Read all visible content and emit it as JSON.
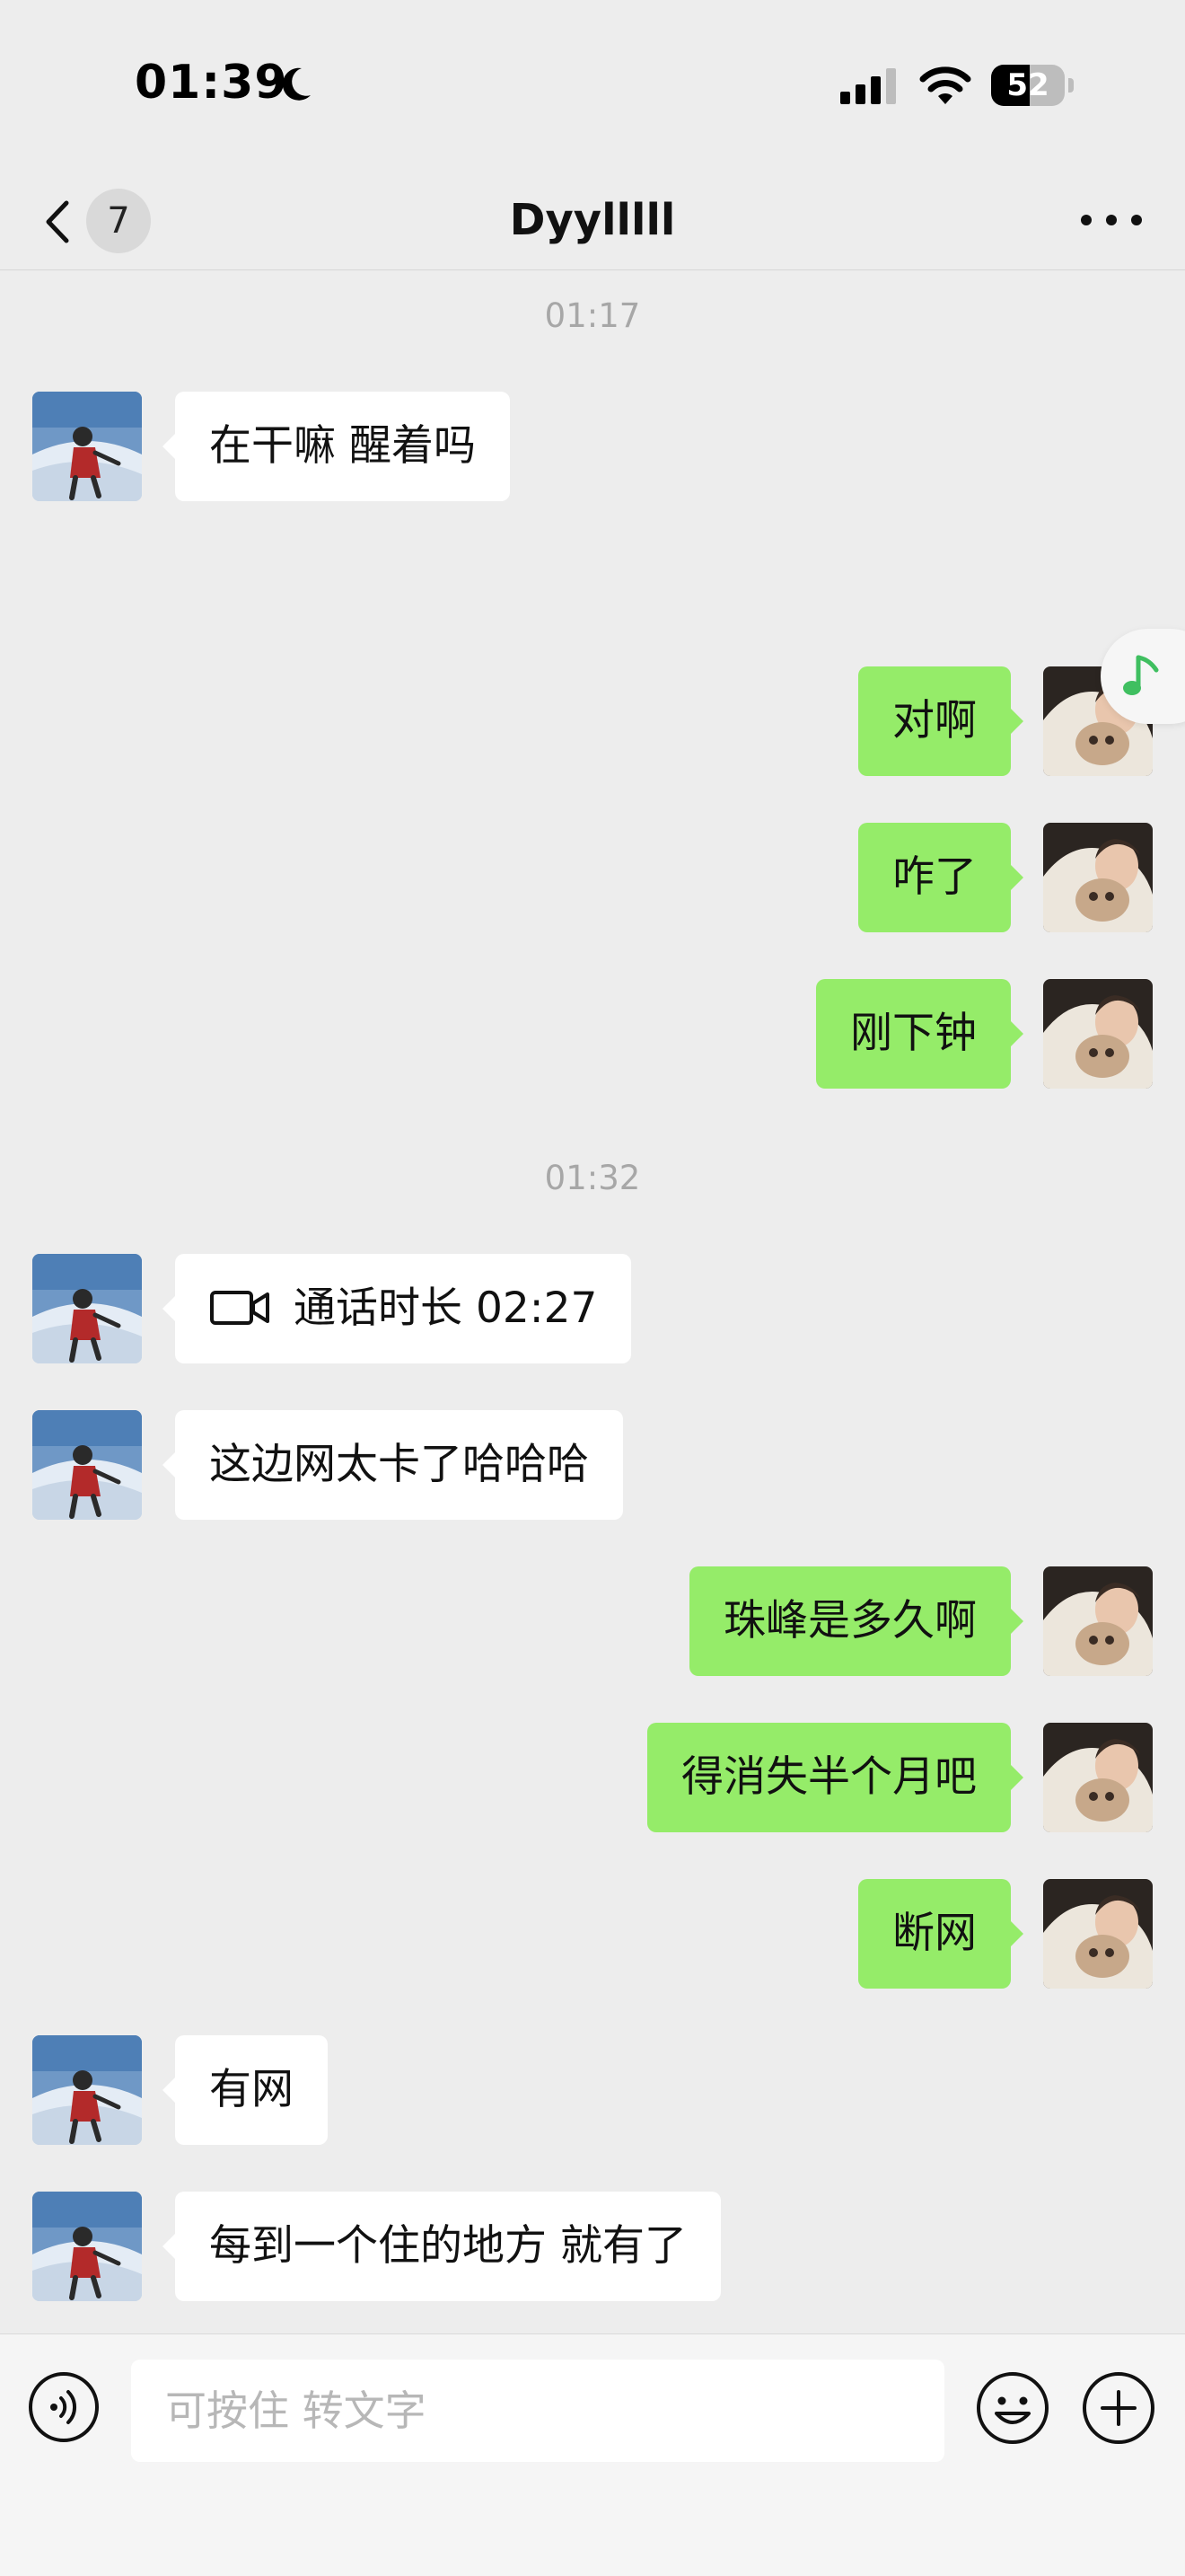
{
  "status_bar": {
    "time": "01:39",
    "moon_icon": "moon-icon",
    "signal_icon": "cellular-signal-icon",
    "wifi_icon": "wifi-icon",
    "battery_level": "52",
    "battery_fraction": 0.52
  },
  "nav": {
    "back_icon": "chevron-left-icon",
    "unread_count": "7",
    "title": "Dyylllll",
    "more_icon": "more-dots-icon"
  },
  "messages": [
    {
      "type": "time",
      "text": "01:17"
    },
    {
      "type": "in",
      "text": "在干嘛 醒着吗"
    },
    {
      "type": "out",
      "text": "对啊"
    },
    {
      "type": "out",
      "text": "咋了"
    },
    {
      "type": "out",
      "text": "刚下钟"
    },
    {
      "type": "time",
      "text": "01:32"
    },
    {
      "type": "in_call",
      "text": "通话时长 02:27",
      "icon": "video-call-icon"
    },
    {
      "type": "in",
      "text": "这边网太卡了哈哈哈"
    },
    {
      "type": "out",
      "text": "珠峰是多久啊"
    },
    {
      "type": "out",
      "text": "得消失半个月吧"
    },
    {
      "type": "out",
      "text": "断网"
    },
    {
      "type": "in",
      "text": "有网"
    },
    {
      "type": "in",
      "text": "每到一个住的地方 就有了"
    }
  ],
  "music_float_icon": "music-note-icon",
  "input_bar": {
    "voice_icon": "voice-input-icon",
    "placeholder": "可按住 转文字",
    "emoji_icon": "emoji-icon",
    "plus_icon": "plus-icon"
  },
  "colors": {
    "background": "#ededed",
    "bubble_out": "#95ec69",
    "bubble_in": "#ffffff",
    "timestamp": "#a7a7a7"
  }
}
